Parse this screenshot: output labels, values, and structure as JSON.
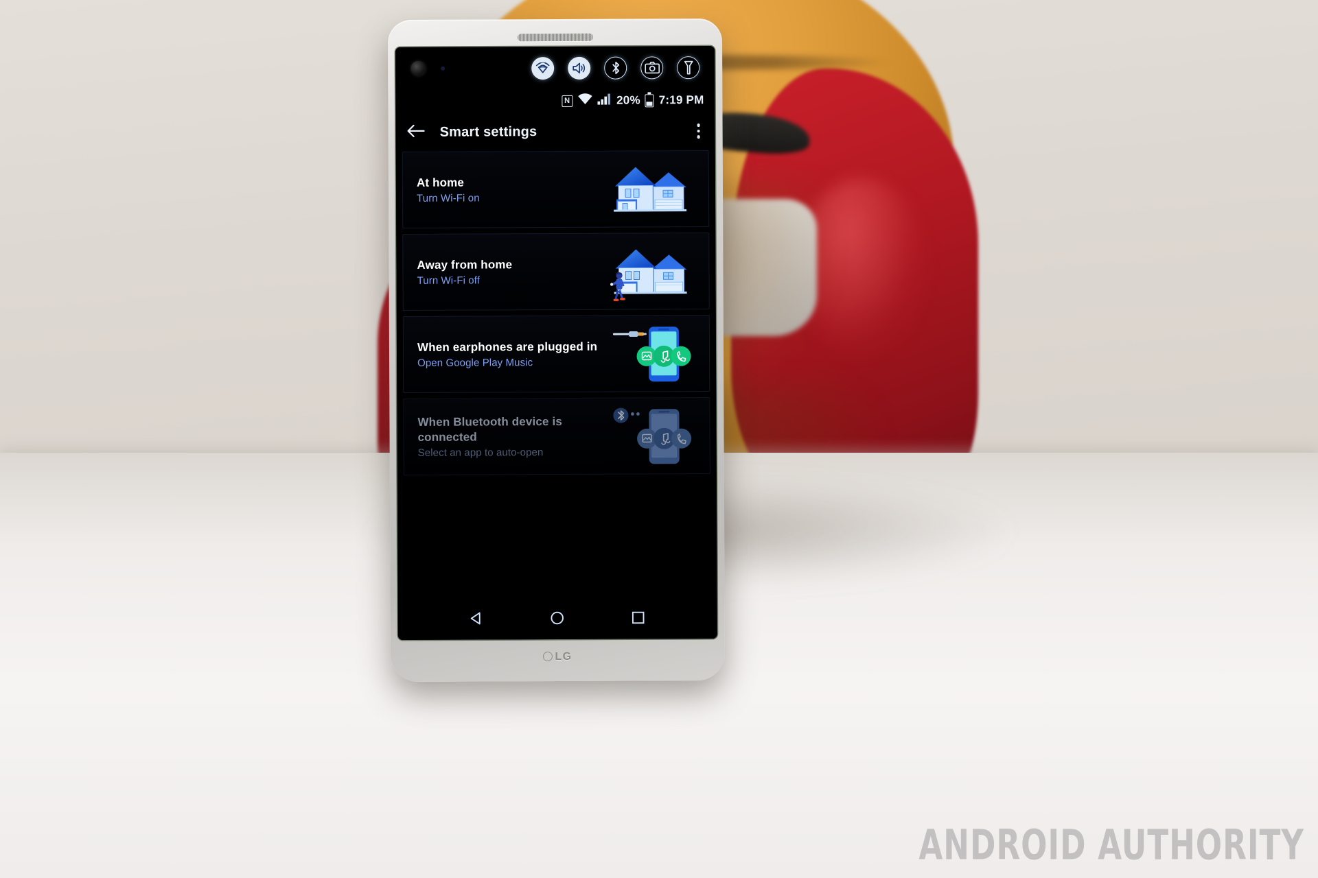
{
  "photo": {
    "subject": "LG V20 smartphone in front of an Iron Man helmet",
    "watermark": "ANDROID AUTHORITY",
    "phone_brand": "LG",
    "colors": {
      "helmet_gold": "#dd9c3c",
      "helmet_red": "#b01821",
      "table": "#f2efed",
      "phone_body": "#cac8c5"
    }
  },
  "second_screen": {
    "icons": [
      {
        "name": "front-camera-lens",
        "glyph": "camera-lens",
        "style": "lens"
      },
      {
        "name": "ir-sensor",
        "glyph": "sensor-dot",
        "style": "dot"
      },
      {
        "name": "wifi-toggle",
        "glyph": "wifi-icon",
        "style": "filled"
      },
      {
        "name": "sound-toggle",
        "glyph": "sound-icon",
        "style": "filled"
      },
      {
        "name": "bluetooth-toggle",
        "glyph": "bluetooth-icon",
        "style": "outlined"
      },
      {
        "name": "camera-shortcut",
        "glyph": "camera-icon",
        "style": "outlined"
      },
      {
        "name": "flashlight-toggle",
        "glyph": "flashlight-icon",
        "style": "outlined"
      }
    ]
  },
  "status_bar": {
    "nfc_label": "N",
    "battery_percent": "20%",
    "time": "7:19 PM",
    "signal_bars": 4,
    "wifi_icon": "wifi-icon",
    "battery_icon": "battery-icon"
  },
  "app_bar": {
    "back_icon": "back-arrow-icon",
    "title": "Smart settings",
    "overflow_icon": "overflow-menu-icon"
  },
  "cards": [
    {
      "title": "At home",
      "subtitle": "Turn Wi-Fi on",
      "art": "house",
      "state": "enabled"
    },
    {
      "title": "Away from home",
      "subtitle": "Turn Wi-Fi off",
      "art": "house-walking-person",
      "state": "enabled"
    },
    {
      "title": "When earphones are plugged in",
      "subtitle": "Open Google Play Music",
      "art": "phone-earphone-jack-apps",
      "state": "enabled"
    },
    {
      "title": "When Bluetooth device is connected",
      "subtitle": "Select an app to auto-open",
      "art": "phone-bluetooth-apps",
      "state": "dimmed"
    }
  ],
  "nav_bar": {
    "back": "back-triangle-icon",
    "home": "home-circle-icon",
    "recents": "recents-square-icon"
  }
}
